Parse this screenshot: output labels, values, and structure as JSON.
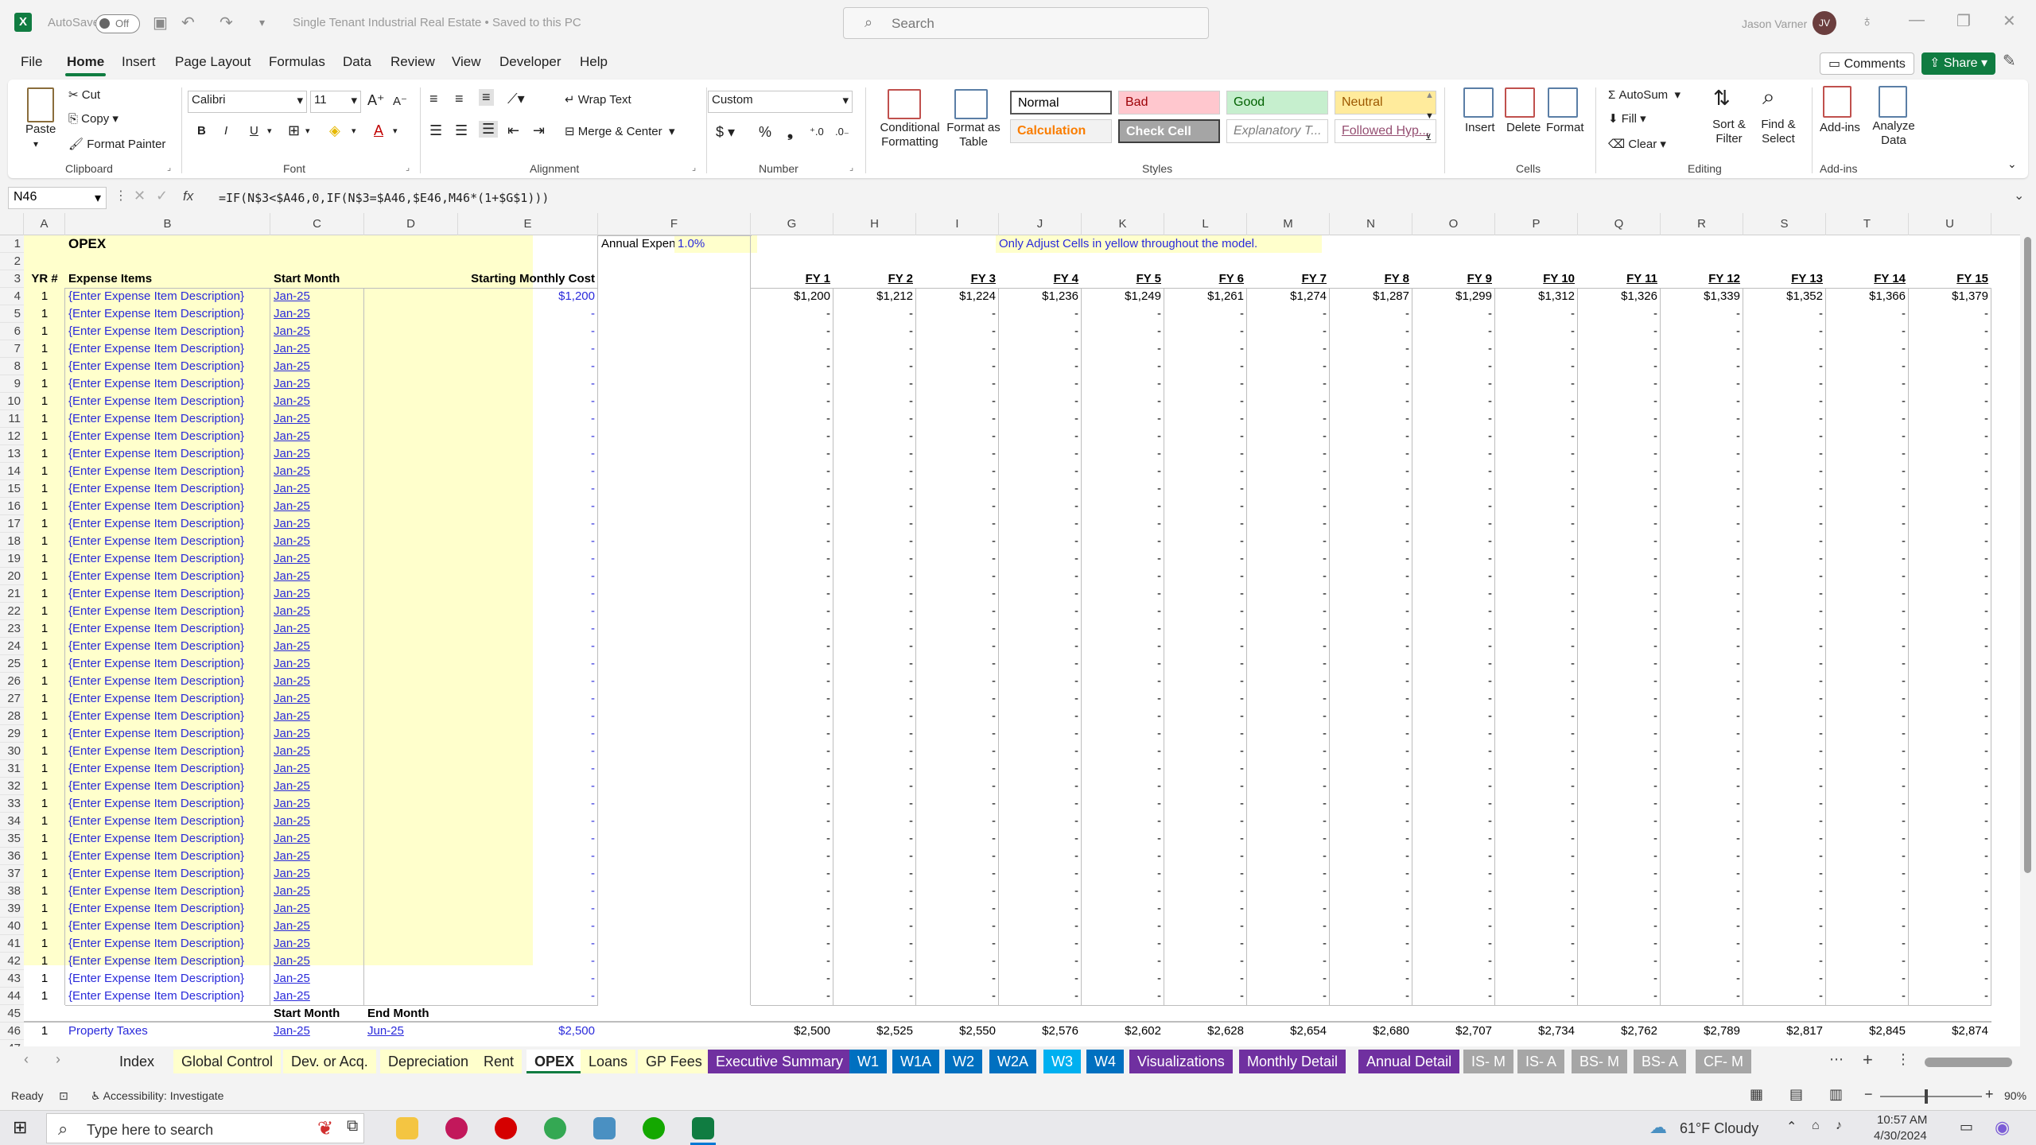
{
  "window": {
    "autosave_label": "AutoSave",
    "autosave_state": "Off",
    "doc_title": "Single Tenant Industrial Real Estate • Saved to this PC",
    "search_placeholder": "Search",
    "user_name": "Jason Varner",
    "user_initials": "JV"
  },
  "menu": {
    "tabs": [
      "File",
      "Home",
      "Insert",
      "Page Layout",
      "Formulas",
      "Data",
      "Review",
      "View",
      "Developer",
      "Help"
    ],
    "active": "Home",
    "comments_label": "Comments",
    "share_label": "Share"
  },
  "ribbon": {
    "clipboard": {
      "paste": "Paste",
      "cut": "Cut",
      "copy": "Copy",
      "format_painter": "Format Painter",
      "group": "Clipboard"
    },
    "font": {
      "name": "Calibri",
      "size": "11",
      "group": "Font"
    },
    "alignment": {
      "wrap_text": "Wrap Text",
      "merge_center": "Merge & Center",
      "group": "Alignment"
    },
    "number": {
      "format": "Custom",
      "group": "Number"
    },
    "styles": {
      "conditional": "Conditional Formatting",
      "format_table": "Format as Table",
      "cells": [
        {
          "label": "Normal",
          "bg": "#ffffff",
          "fg": "#000000"
        },
        {
          "label": "Bad",
          "bg": "#ffc7ce",
          "fg": "#9c0006"
        },
        {
          "label": "Good",
          "bg": "#c6efce",
          "fg": "#006100"
        },
        {
          "label": "Neutral",
          "bg": "#ffeb9c",
          "fg": "#9c5700"
        },
        {
          "label": "Calculation",
          "bg": "#f2f2f2",
          "fg": "#fa7d00"
        },
        {
          "label": "Check Cell",
          "bg": "#a5a5a5",
          "fg": "#ffffff"
        },
        {
          "label": "Explanatory T...",
          "bg": "#ffffff",
          "fg": "#7f7f7f"
        },
        {
          "label": "Followed Hyp...",
          "bg": "#ffffff",
          "fg": "#954f72"
        }
      ],
      "group": "Styles"
    },
    "cells": {
      "insert": "Insert",
      "delete": "Delete",
      "format": "Format",
      "group": "Cells"
    },
    "editing": {
      "autosum": "AutoSum",
      "fill": "Fill",
      "clear": "Clear",
      "sort_filter": "Sort & Filter",
      "find_select": "Find & Select",
      "group": "Editing"
    },
    "addins": {
      "addins": "Add-ins",
      "analyze": "Analyze Data",
      "group": "Add-ins"
    }
  },
  "formula_bar": {
    "name_box": "N46",
    "fx": "fx",
    "formula": "=IF(N$3<$A46,0,IF(N$3=$A46,$E46,M46*(1+$G$1)))"
  },
  "sheet": {
    "columns": [
      "A",
      "B",
      "C",
      "D",
      "E",
      "F",
      "G",
      "H",
      "I",
      "J",
      "K",
      "L",
      "M",
      "N",
      "O",
      "P",
      "Q",
      "R",
      "S",
      "T",
      "U"
    ],
    "title": "OPEX",
    "annual_increase_label": "Annual Expense Increase:",
    "annual_increase_value": "1.0%",
    "note": "Only Adjust Cells in yellow throughout the model.",
    "headers": {
      "yr": "YR #",
      "item": "Expense Items",
      "start": "Start Month",
      "cost": "Starting Monthly Cost"
    },
    "fy_headers": [
      "FY 1",
      "FY 2",
      "FY 3",
      "FY 4",
      "FY 5",
      "FY 6",
      "FY 7",
      "FY 8",
      "FY 9",
      "FY 10",
      "FY 11",
      "FY 12",
      "FY 13",
      "FY 14",
      "FY 15"
    ],
    "row4_values": [
      "$1,200",
      "$1,212",
      "$1,224",
      "$1,236",
      "$1,249",
      "$1,261",
      "$1,274",
      "$1,287",
      "$1,299",
      "$1,312",
      "$1,326",
      "$1,339",
      "$1,352",
      "$1,366",
      "$1,379"
    ],
    "expense_row": {
      "yr": "1",
      "item": "{Enter Expense Item Description}",
      "start": "Jan-25",
      "first_cost": "$1,200",
      "blank_cost": "-"
    },
    "row45": {
      "start": "Start Month",
      "end": "End Month"
    },
    "row46": {
      "yr": "1",
      "item": "Property Taxes",
      "start": "Jan-25",
      "end": "Jun-25",
      "cost": "$2,500",
      "values": [
        "$2,500",
        "$2,525",
        "$2,550",
        "$2,576",
        "$2,602",
        "$2,628",
        "$2,654",
        "$2,680",
        "$2,707",
        "$2,734",
        "$2,762",
        "$2,789",
        "$2,817",
        "$2,845",
        "$2,874"
      ]
    }
  },
  "sheet_tabs": [
    {
      "label": "Index",
      "bg": "",
      "fg": "#222222"
    },
    {
      "label": "Global Control",
      "bg": "#ffffcc",
      "fg": "#222222"
    },
    {
      "label": "Dev. or Acq.",
      "bg": "#ffffcc",
      "fg": "#222222"
    },
    {
      "label": "Depreciation",
      "bg": "#ffffcc",
      "fg": "#222222"
    },
    {
      "label": "Rent",
      "bg": "#ffffcc",
      "fg": "#222222"
    },
    {
      "label": "OPEX",
      "bg": "#ffffff",
      "fg": "#222222",
      "active": true
    },
    {
      "label": "Loans",
      "bg": "#ffffcc",
      "fg": "#222222"
    },
    {
      "label": "GP Fees",
      "bg": "#ffffcc",
      "fg": "#222222"
    },
    {
      "label": "Executive Summary",
      "bg": "#7030a0",
      "fg": "#ffffff"
    },
    {
      "label": "W1",
      "bg": "#0070c0",
      "fg": "#ffffff"
    },
    {
      "label": "W1A",
      "bg": "#0070c0",
      "fg": "#ffffff"
    },
    {
      "label": "W2",
      "bg": "#0070c0",
      "fg": "#ffffff"
    },
    {
      "label": "W2A",
      "bg": "#0070c0",
      "fg": "#ffffff"
    },
    {
      "label": "W3",
      "bg": "#00b0f0",
      "fg": "#ffffff"
    },
    {
      "label": "W4",
      "bg": "#0070c0",
      "fg": "#ffffff"
    },
    {
      "label": "Visualizations",
      "bg": "#7030a0",
      "fg": "#ffffff"
    },
    {
      "label": "Monthly Detail",
      "bg": "#7030a0",
      "fg": "#ffffff"
    },
    {
      "label": "Annual Detail",
      "bg": "#7030a0",
      "fg": "#ffffff"
    },
    {
      "label": "IS- M",
      "bg": "#a6a6a6",
      "fg": "#ffffff"
    },
    {
      "label": "IS- A",
      "bg": "#a6a6a6",
      "fg": "#ffffff"
    },
    {
      "label": "BS- M",
      "bg": "#a6a6a6",
      "fg": "#ffffff"
    },
    {
      "label": "BS- A",
      "bg": "#a6a6a6",
      "fg": "#ffffff"
    },
    {
      "label": "CF- M",
      "bg": "#a6a6a6",
      "fg": "#ffffff"
    }
  ],
  "status": {
    "ready": "Ready",
    "accessibility": "Accessibility: Investigate",
    "zoom": "90%"
  },
  "taskbar": {
    "search_placeholder": "Type here to search",
    "weather": "61°F  Cloudy",
    "time": "10:57 AM",
    "date": "4/30/2024"
  }
}
